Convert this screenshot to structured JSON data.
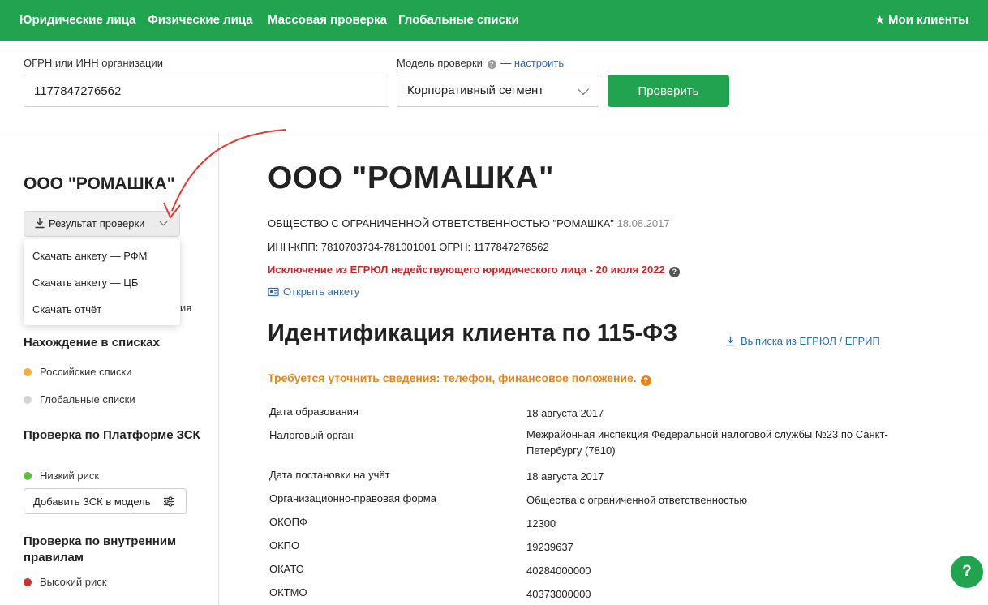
{
  "nav": {
    "items": [
      "Юридические лица",
      "Физические лица",
      "Массовая проверка",
      "Глобальные списки"
    ],
    "my_clients": "Мои клиенты"
  },
  "search": {
    "ogrn_label": "ОГРН или ИНН организации",
    "ogrn_value": "1177847276562",
    "model_label": "Модель проверки",
    "model_dash": "—",
    "model_configure": "настроить",
    "model_value": "Корпоративный сегмент",
    "check_button": "Проверить"
  },
  "sidebar": {
    "company": "ООО \"РОМАШКА\"",
    "result_button": "Результат проверки",
    "dropdown": [
      "Скачать анкету — РФМ",
      "Скачать анкету — ЦБ",
      "Скачать отчёт"
    ],
    "hidden_tail": "ия",
    "lists_title": "Нахождение в списках",
    "lists": [
      {
        "label": "Российские списки",
        "color": "#f2b134"
      },
      {
        "label": "Глобальные списки",
        "color": "#d4d4d4"
      }
    ],
    "platform_title": "Проверка по Платформе ЗСК",
    "platform_status": {
      "label": "Низкий риск",
      "color": "#5bbf3e"
    },
    "zsk_button": "Добавить ЗСК в модель",
    "internal_title": "Проверка по внутренним правилам",
    "internal_status": {
      "label": "Высокий риск",
      "color": "#d32f2f"
    }
  },
  "main": {
    "title": "ООО \"РОМАШКА\"",
    "full_name": "ОБЩЕСТВО С ОГРАНИЧЕННОЙ ОТВЕТСТВЕННОСТЬЮ \"РОМАШКА\"",
    "full_name_date": "18.08.2017",
    "inn_line": "ИНН-КПП: 7810703734-781001001 ОГРН: 1177847276562",
    "exclusion": "Исключение из ЕГРЮЛ недействующего юридического лица - 20 июля 2022",
    "open_form": "Открыть анкету",
    "section_title": "Идентификация клиента по 115-ФЗ",
    "egrul_link": "Выписка из ЕГРЮЛ / ЕГРИП",
    "warning": "Требуется уточнить сведения: телефон, финансовое положение.",
    "rows": [
      {
        "k": "Дата образования",
        "v": "18 августа 2017"
      },
      {
        "k": "Налоговый орган",
        "v": "Межрайонная инспекция Федеральной налоговой службы №23 по Санкт-Петербургу (7810)"
      },
      {
        "k": "Дата постановки на учёт",
        "v": "18 августа 2017"
      },
      {
        "k": "Организационно-правовая форма",
        "v": "Общества с ограниченной ответственностью"
      },
      {
        "k": "ОКОПФ",
        "v": "12300"
      },
      {
        "k": "ОКПО",
        "v": "19239637"
      },
      {
        "k": "ОКАТО",
        "v": "40284000000"
      },
      {
        "k": "ОКТМО",
        "v": "40373000000"
      }
    ]
  },
  "help_fab": "?",
  "colors": {
    "brand": "#21a34f",
    "link": "#2b6cb0",
    "error": "#c62828",
    "warning": "#e3861a"
  }
}
